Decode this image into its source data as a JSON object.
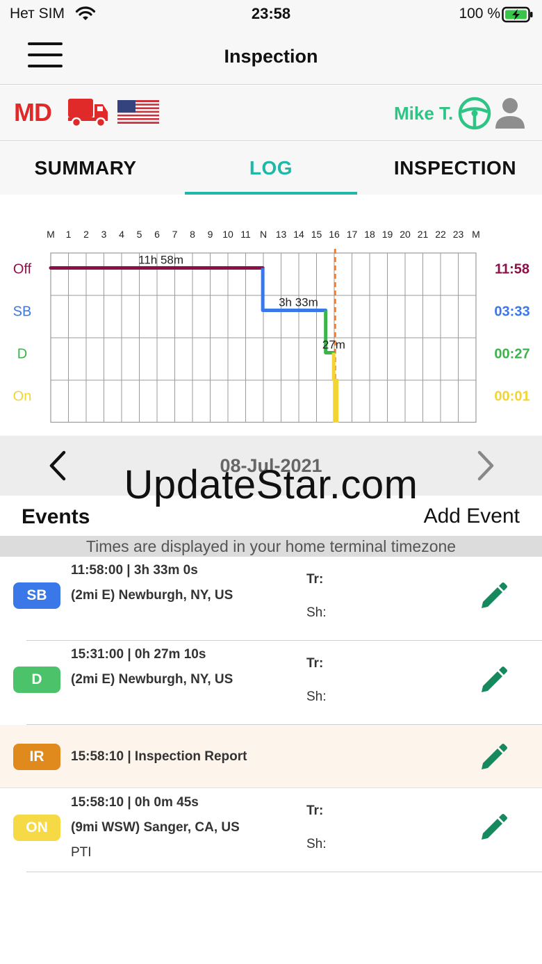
{
  "status_bar": {
    "carrier": "Нет SIM",
    "time": "23:58",
    "battery": "100 %"
  },
  "nav": {
    "title": "Inspection"
  },
  "driver": {
    "duty_code": "MD",
    "name": "Mike T."
  },
  "tabs": [
    {
      "label": "SUMMARY",
      "active": false
    },
    {
      "label": "LOG",
      "active": true
    },
    {
      "label": "INSPECTION",
      "active": false
    }
  ],
  "chart_data": {
    "type": "line",
    "hours": [
      "M",
      "1",
      "2",
      "3",
      "4",
      "5",
      "6",
      "7",
      "8",
      "9",
      "10",
      "11",
      "N",
      "13",
      "14",
      "15",
      "16",
      "17",
      "18",
      "19",
      "20",
      "21",
      "22",
      "23",
      "M"
    ],
    "rows": [
      {
        "label": "Off",
        "total": "11:58",
        "color": "#8c1048"
      },
      {
        "label": "SB",
        "total": "03:33",
        "color": "#3a77e8"
      },
      {
        "label": "D",
        "total": "00:27",
        "color": "#39b54a"
      },
      {
        "label": "On",
        "total": "00:01",
        "color": "#f2d534"
      }
    ],
    "segments": [
      {
        "status": "Off",
        "start": 0,
        "end": 11.967,
        "label": "11h 58m"
      },
      {
        "status": "SB",
        "start": 11.967,
        "end": 15.517,
        "label": "3h 33m"
      },
      {
        "status": "D",
        "start": 15.517,
        "end": 15.967,
        "label": "27m"
      },
      {
        "status": "On",
        "start": 15.967,
        "end": 15.98,
        "label": ""
      }
    ],
    "current_time": 15.97,
    "current_time_color": "#f07b2a"
  },
  "date_nav": {
    "date": "08-Jul-2021"
  },
  "watermark": "UpdateStar.com",
  "events_header": {
    "title": "Events",
    "add_label": "Add Event",
    "timezone_note": "Times are displayed in your home terminal timezone"
  },
  "events": [
    {
      "badge": "SB",
      "badge_color": "#3a77e8",
      "time": "11:58:00 | 3h 33m 0s",
      "location": "(2mi E) Newburgh, NY, US",
      "note": "",
      "tr": "Tr:",
      "sh": "Sh:"
    },
    {
      "badge": "D",
      "badge_color": "#4cc26a",
      "time": "15:31:00 | 0h 27m 10s",
      "location": "(2mi E) Newburgh, NY, US",
      "note": "",
      "tr": "Tr:",
      "sh": "Sh:"
    },
    {
      "badge": "IR",
      "badge_color": "#e08a1e",
      "time": "15:58:10 | Inspection Report",
      "location": "",
      "note": "",
      "tr": "",
      "sh": ""
    },
    {
      "badge": "ON",
      "badge_color": "#f5da45",
      "time": "15:58:10 | 0h 0m 45s",
      "location": "(9mi WSW) Sanger, CA, US",
      "note": "PTI",
      "tr": "Tr:",
      "sh": "Sh:"
    }
  ],
  "colors": {
    "accent": "#1db9a6",
    "driver_green": "#2ec486",
    "duty_red": "#e02a2a",
    "edit_green": "#168a5e"
  }
}
